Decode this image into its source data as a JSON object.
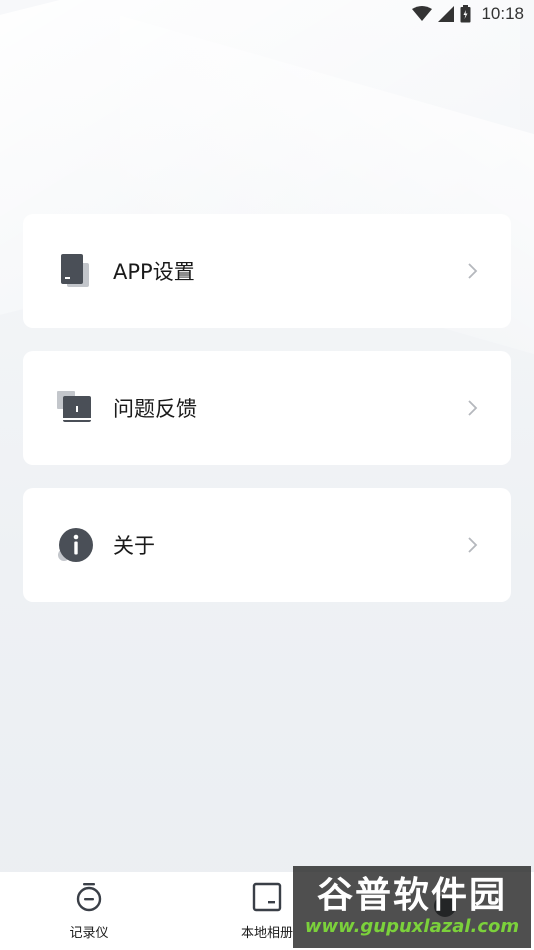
{
  "status_bar": {
    "time": "10:18",
    "icons": [
      "wifi-icon",
      "signal-icon",
      "battery-icon"
    ]
  },
  "menu": {
    "items": [
      {
        "label": "APP设置",
        "icon": "app-settings-icon"
      },
      {
        "label": "问题反馈",
        "icon": "feedback-book-icon"
      },
      {
        "label": "关于",
        "icon": "info-icon"
      }
    ],
    "chevron_icon": "chevron-right-icon"
  },
  "tab_bar": {
    "items": [
      {
        "label": "记录仪",
        "icon": "recorder-icon"
      },
      {
        "label": "本地相册",
        "icon": "album-icon"
      },
      {
        "label": "",
        "icon": "settings-icon"
      }
    ]
  },
  "watermark": {
    "title": "谷普软件园",
    "url": "www.gupuxlazal.com"
  },
  "colors": {
    "icon_dark": "#4a4f57",
    "icon_light": "#c3c6cb",
    "chevron": "#b5b8bd",
    "watermark_green": "#7bd13b"
  }
}
